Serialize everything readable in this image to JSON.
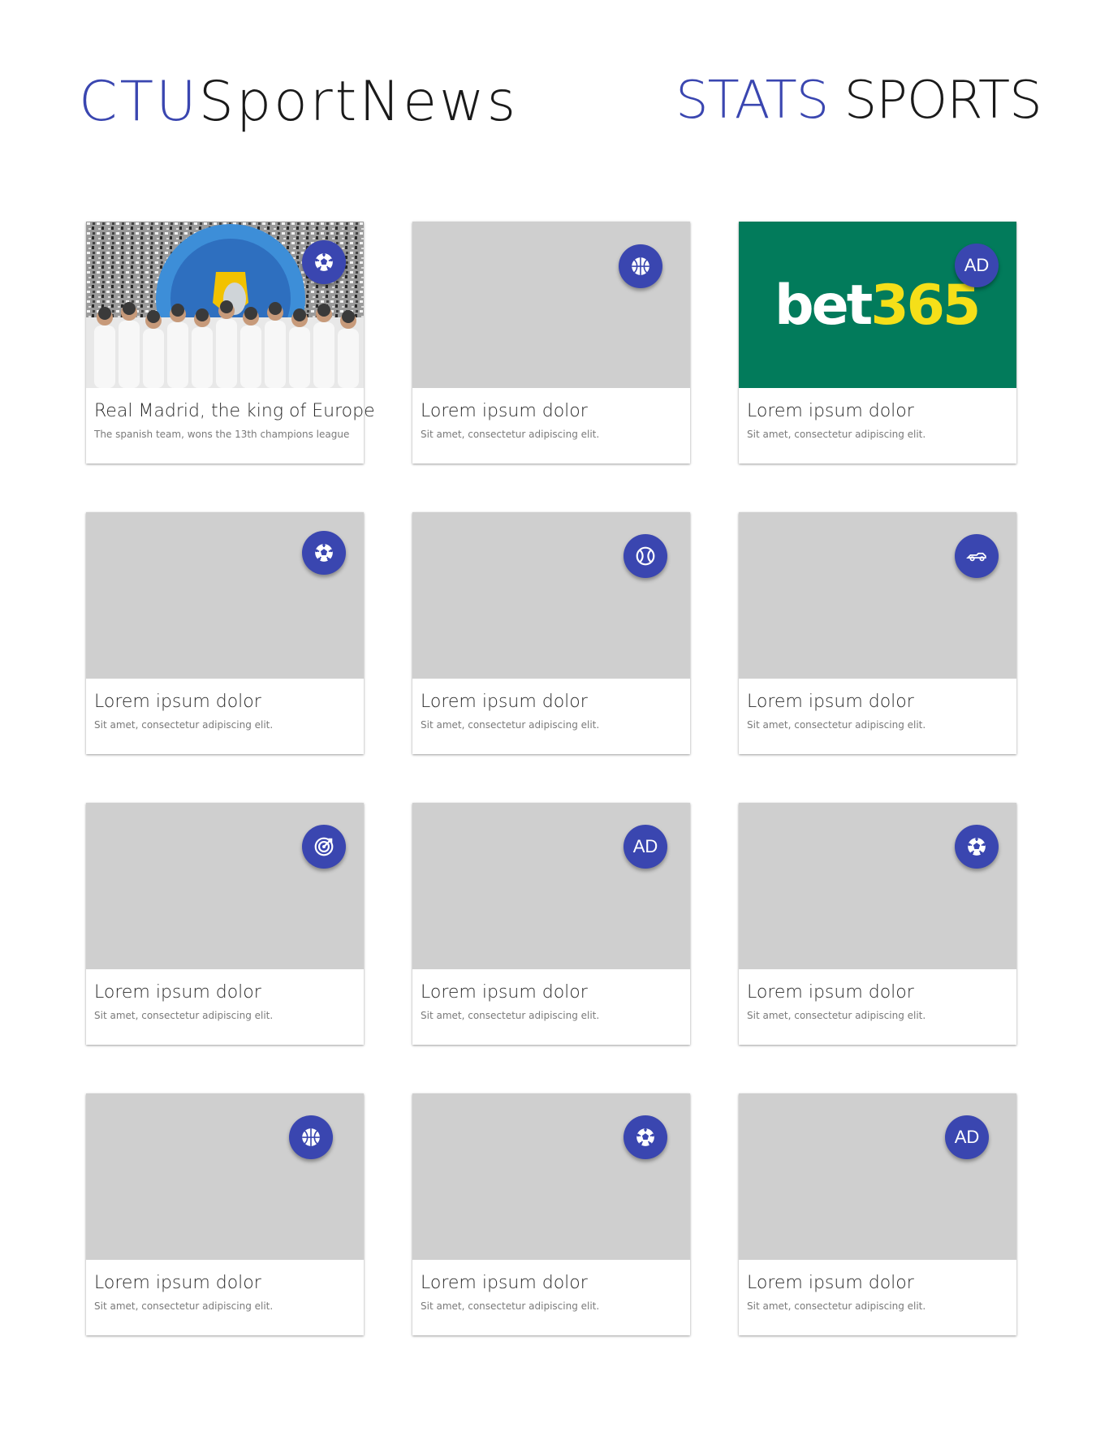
{
  "header": {
    "left_logo": {
      "accent": "CTU",
      "rest": "SportNews"
    },
    "right_logo": {
      "accent": "STATS",
      "rest": "SPORTS"
    }
  },
  "colors": {
    "accent": "#3a46b0",
    "placeholder": "#cfcfcf",
    "ad_green": "#027b5b",
    "ad_yellow": "#f5df19"
  },
  "cards": [
    {
      "title": "Real Madrid, the king of Europe",
      "subtitle": "The spanish team, wons the 13th champions league",
      "badge_icon": "soccer-ball-icon",
      "media": "photo"
    },
    {
      "title": "Lorem ipsum dolor",
      "subtitle": "Sit amet, consectetur adipiscing elit.",
      "badge_icon": "basketball-icon",
      "media": "placeholder"
    },
    {
      "title": "Lorem ipsum dolor",
      "subtitle": "Sit amet, consectetur adipiscing elit.",
      "badge_text": "AD",
      "media": "ad",
      "ad": {
        "white": "bet",
        "yellow": "365"
      }
    },
    {
      "title": "Lorem ipsum dolor",
      "subtitle": "Sit amet, consectetur adipiscing elit.",
      "badge_icon": "soccer-ball-icon",
      "media": "placeholder"
    },
    {
      "title": "Lorem ipsum dolor",
      "subtitle": "Sit amet, consectetur adipiscing elit.",
      "badge_icon": "tennis-ball-icon",
      "media": "placeholder"
    },
    {
      "title": "Lorem ipsum dolor",
      "subtitle": "Sit amet, consectetur adipiscing elit.",
      "badge_icon": "race-car-icon",
      "media": "placeholder"
    },
    {
      "title": "Lorem ipsum dolor",
      "subtitle": "Sit amet, consectetur adipiscing elit.",
      "badge_icon": "target-icon",
      "media": "placeholder"
    },
    {
      "title": "Lorem ipsum dolor",
      "subtitle": "Sit amet, consectetur adipiscing elit.",
      "badge_text": "AD",
      "media": "placeholder"
    },
    {
      "title": "Lorem ipsum dolor",
      "subtitle": "Sit amet, consectetur adipiscing elit.",
      "badge_icon": "soccer-ball-icon",
      "media": "placeholder"
    },
    {
      "title": "Lorem ipsum dolor",
      "subtitle": "Sit amet, consectetur adipiscing elit.",
      "badge_icon": "basketball-icon",
      "media": "placeholder"
    },
    {
      "title": "Lorem ipsum dolor",
      "subtitle": "Sit amet, consectetur adipiscing elit.",
      "badge_icon": "soccer-ball-icon",
      "media": "placeholder"
    },
    {
      "title": "Lorem ipsum dolor",
      "subtitle": "Sit amet, consectetur adipiscing elit.",
      "badge_text": "AD",
      "media": "placeholder"
    }
  ]
}
